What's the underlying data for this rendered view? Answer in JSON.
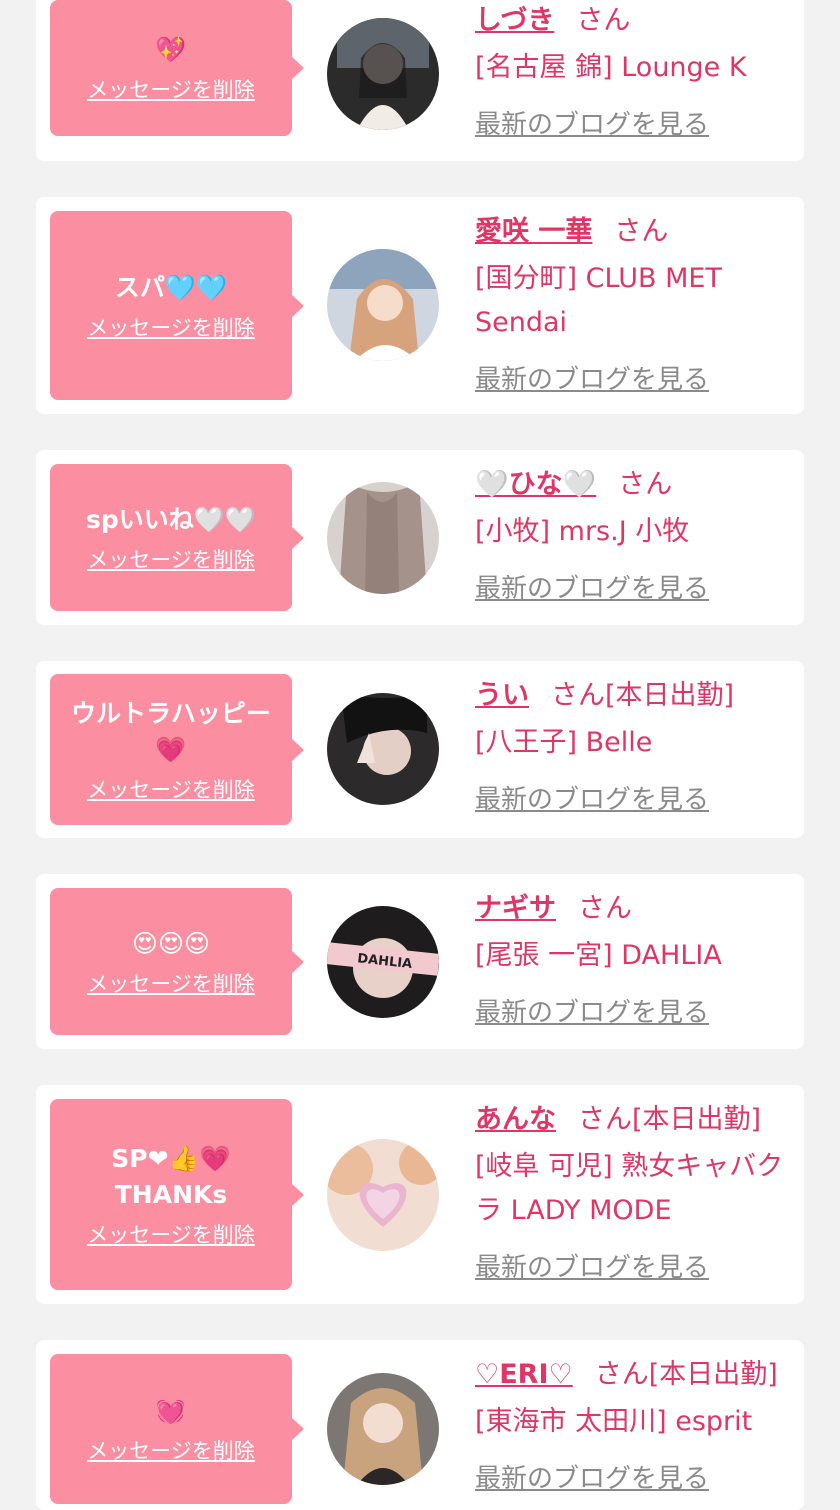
{
  "cards": [
    {
      "message": "💖",
      "delete_label": "メッセージを削除",
      "name": "しづき",
      "suffix": "さん",
      "shop": "[名古屋 錦] Lounge K",
      "blog_label": "最新のブログを見る"
    },
    {
      "message": "スパ🩵🩵",
      "delete_label": "メッセージを削除",
      "name": "愛咲 一華",
      "suffix": "さん",
      "shop": "[国分町] CLUB MET Sendai",
      "blog_label": "最新のブログを見る"
    },
    {
      "message": "spいいね🤍🤍",
      "delete_label": "メッセージを削除",
      "name": "🤍ひな🤍",
      "suffix": "さん",
      "shop": "[小牧] mrs.J 小牧",
      "blog_label": "最新のブログを見る"
    },
    {
      "message": "ウルトラハッピー💗",
      "delete_label": "メッセージを削除",
      "name": "うい",
      "suffix": "さん[本日出勤]",
      "shop": "[八王子] Belle",
      "blog_label": "最新のブログを見る"
    },
    {
      "message": "😍😍😍",
      "delete_label": "メッセージを削除",
      "name": "ナギサ",
      "suffix": "さん",
      "shop": "[尾張 一宮] DAHLIA",
      "avatar_text": "DAHLIA",
      "blog_label": "最新のブログを見る"
    },
    {
      "message": "SP❤👍💗THANKs",
      "delete_label": "メッセージを削除",
      "name": "あんな",
      "suffix": "さん[本日出勤]",
      "shop": "[岐阜 可児] 熟女キャバクラ LADY MODE",
      "blog_label": "最新のブログを見る"
    },
    {
      "message": "💓",
      "delete_label": "メッセージを削除",
      "name": "♡ERI♡",
      "suffix": "さん[本日出勤]",
      "shop": "[東海市 太田川] esprit",
      "blog_label": "最新のブログを見る"
    }
  ],
  "colors": {
    "accent": "#e03565",
    "message_bg": "#fb8ea0",
    "link_gray": "#8a8a8a",
    "page_bg": "#f2f2f2"
  }
}
